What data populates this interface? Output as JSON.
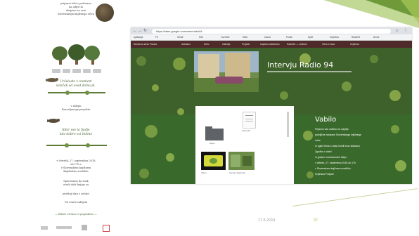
{
  "invitation": {
    "line1": "pripravi tebi v prebrano",
    "line2": "na odpri in",
    "line3": "skupino na vrtu",
    "line4": "Slovenskega knjižnega vrtca",
    "script1a": "Uršulaste v oraniem",
    "script1b": "kotiček od ovod doma pl.",
    "mid1": "v sklopu",
    "mid2": "Ponovljenega projekta",
    "script2a": "Kdor vse ta ljudje",
    "script2b": "kdo dobro vsi želimo",
    "date": "v četrtek, 27. septembra 2018",
    "time": "ob 17h v",
    "place1": "v Slovenskem knjižnem",
    "place2": "Knjižnično središče",
    "small1": "Sporočamo da vsak",
    "small2": "otrok dobi knjigo za",
    "small3": "jutrišnji dan s sošolci",
    "small4": "Vsi starši vabljeni",
    "footer_script": "— Rdečo vrtnico in pogostitev —"
  },
  "browser": {
    "url": "https://sites.google.com/view/radio94",
    "bookmarks": [
      "Aplikacije",
      "Fb",
      "Gmail",
      "SiOl",
      "YouTube",
      "Sites",
      "Zavod",
      "Portal",
      "Splet",
      "Knjižnica",
      "Radio94",
      "Arnes"
    ],
    "nav": [
      "Naslovna stran Pravila",
      "Aktualno",
      "Arhiv",
      "Galerija",
      "Projekti",
      "Zapiski sodelavcev",
      "Radio94 — vsebine",
      "Vrtec in šola",
      "Knjižnice"
    ]
  },
  "page": {
    "title": "Intervju Radio 94",
    "vabilo": "Vabilo",
    "vabilo_lines": [
      "Prijazno vas vabimo na odprtje",
      "pravljične razstave Slovenskega knjižnega",
      "vrtca",
      "in ogled filma o radiu Dobili smo slikanico",
      "Zgodba o dobri",
      "in gostom mednarodne ekipe",
      "v četrtek, 27. septembra 2018 ob 17h",
      "v Slovenskem knjižnem središču",
      "Knjižnica Podpeč"
    ],
    "file_captions": [
      "Mapa",
      "Datoteka",
      "Video",
      "Intervju Radio 94"
    ]
  },
  "footer": {
    "date": "17.5.2019",
    "page": "37"
  }
}
